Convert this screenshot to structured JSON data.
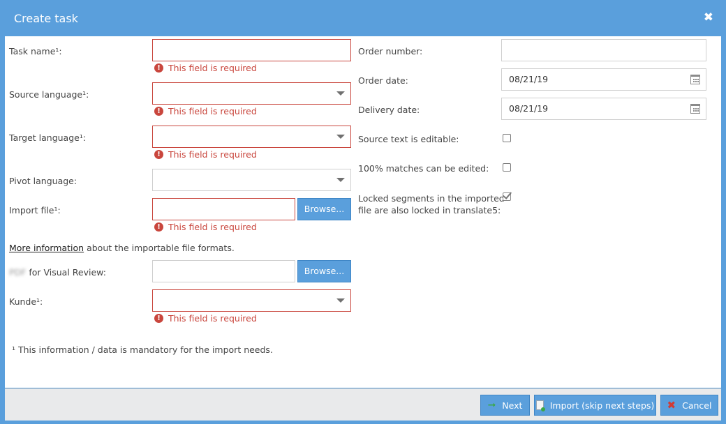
{
  "dialog": {
    "title": "Create task",
    "close": "✖"
  },
  "left": {
    "task_name": {
      "label": "Task name¹:",
      "value": "",
      "error": "This field is required"
    },
    "source_language": {
      "label": "Source language¹:",
      "value": "",
      "error": "This field is required"
    },
    "target_language": {
      "label": "Target language¹:",
      "value": "",
      "error": "This field is required"
    },
    "pivot_language": {
      "label": "Pivot language:",
      "value": ""
    },
    "import_file": {
      "label": "Import file¹:",
      "value": "",
      "button": "Browse...",
      "error": "This field is required"
    },
    "more_info": {
      "link": "More information",
      "text": " about the importable file formats."
    },
    "visual_review": {
      "blurred_prefix": "PDF",
      "label": " for Visual Review:",
      "value": "",
      "button": "Browse..."
    },
    "kunde": {
      "label": "Kunde¹:",
      "value": "",
      "error": "This field is required"
    },
    "footnote": "¹ This information / data is mandatory for the import needs."
  },
  "right": {
    "order_number": {
      "label": "Order number:",
      "value": ""
    },
    "order_date": {
      "label": "Order date:",
      "value": "08/21/19"
    },
    "delivery_date": {
      "label": "Delivery date:",
      "value": "08/21/19"
    },
    "source_editable": {
      "label": "Source text is editable:",
      "checked": false
    },
    "matches_editable": {
      "label": "100% matches can be edited:",
      "checked": false
    },
    "locked_segments": {
      "label_line1": "Locked segments in the imported",
      "label_line2": "file are also locked in translate5:",
      "checked": true
    }
  },
  "footer": {
    "next": "Next",
    "import": "Import (skip next steps)",
    "cancel": "Cancel"
  },
  "icons": {
    "error": "exclamation-circle-icon",
    "calendar": "calendar-icon",
    "next": "green-arrow-icon",
    "import": "document-add-icon",
    "cancel": "red-x-icon"
  },
  "colors": {
    "accent": "#5a9fdc",
    "error": "#c9463d"
  }
}
